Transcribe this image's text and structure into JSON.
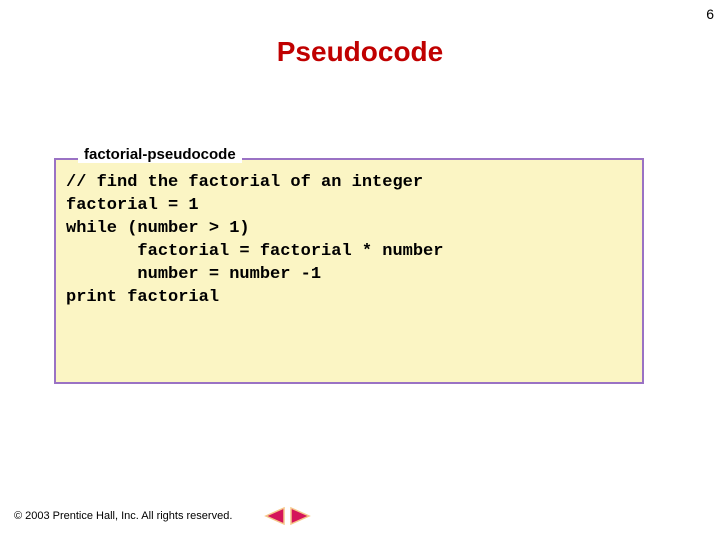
{
  "page_number": "6",
  "title": "Pseudocode",
  "frame_label": "factorial-pseudocode",
  "code": {
    "l1": "// find the factorial of an integer",
    "l2": "factorial = 1",
    "l3": "while (number > 1)",
    "l4": "       factorial = factorial * number",
    "l5": "       number = number -1",
    "l6": "print factorial"
  },
  "footer": {
    "copyright_symbol": "©",
    "copyright_text": "2003 Prentice Hall, Inc.  All rights reserved."
  },
  "icons": {
    "prev": "prev-arrow-icon",
    "next": "next-arrow-icon"
  },
  "colors": {
    "title": "#c00000",
    "frame_border": "#9a72c4",
    "frame_bg": "#fbf5c4",
    "arrow_fill": "#d4145a",
    "arrow_stroke": "#f5c689"
  }
}
